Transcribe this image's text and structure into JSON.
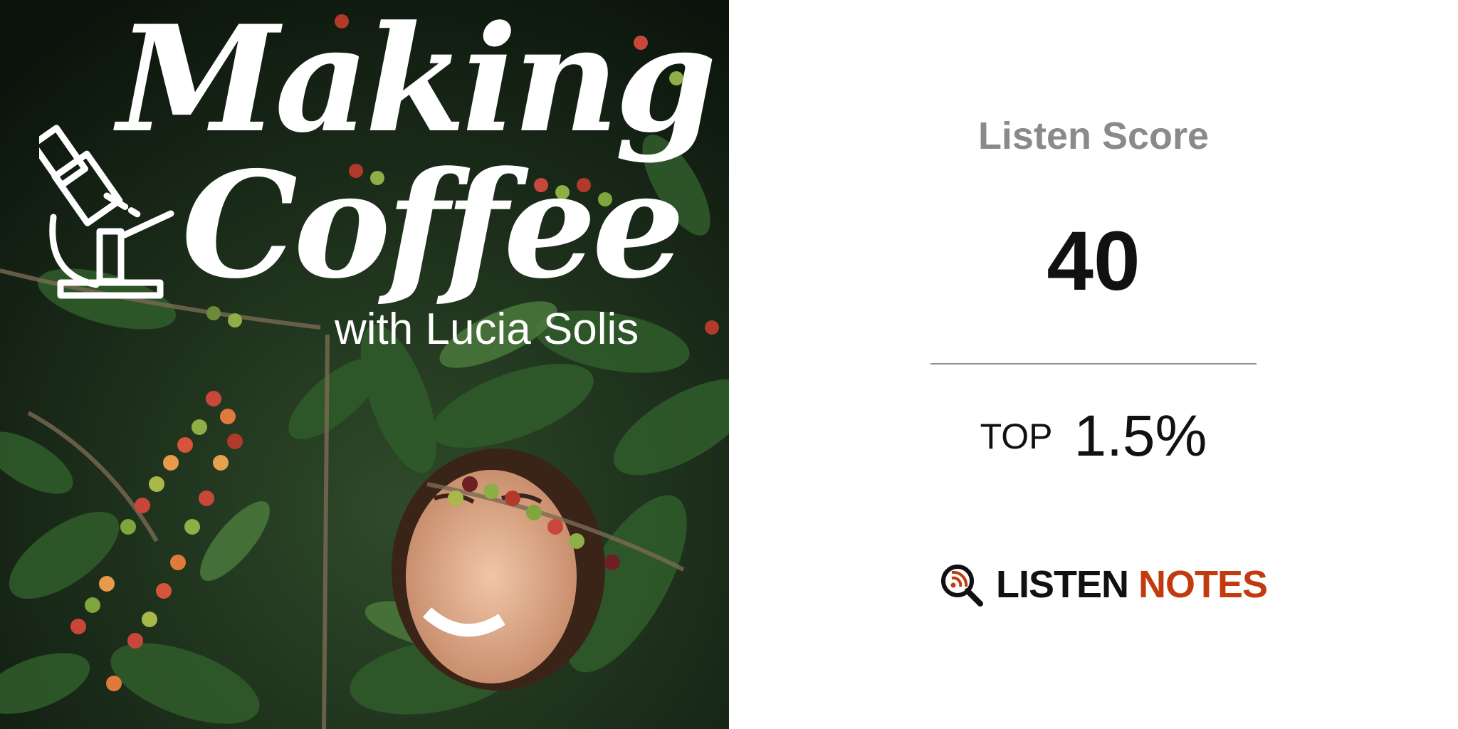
{
  "cover": {
    "title_line1": "Making",
    "title_line2": "Coffee",
    "subtitle": "with Lucia Solis"
  },
  "score": {
    "label": "Listen Score",
    "value": "40",
    "rank_prefix": "TOP",
    "rank_value": "1.5%"
  },
  "brand": {
    "name_part1": "LISTEN",
    "name_part2": "NOTES",
    "color_dark": "#111111",
    "color_accent": "#c23b0f"
  }
}
